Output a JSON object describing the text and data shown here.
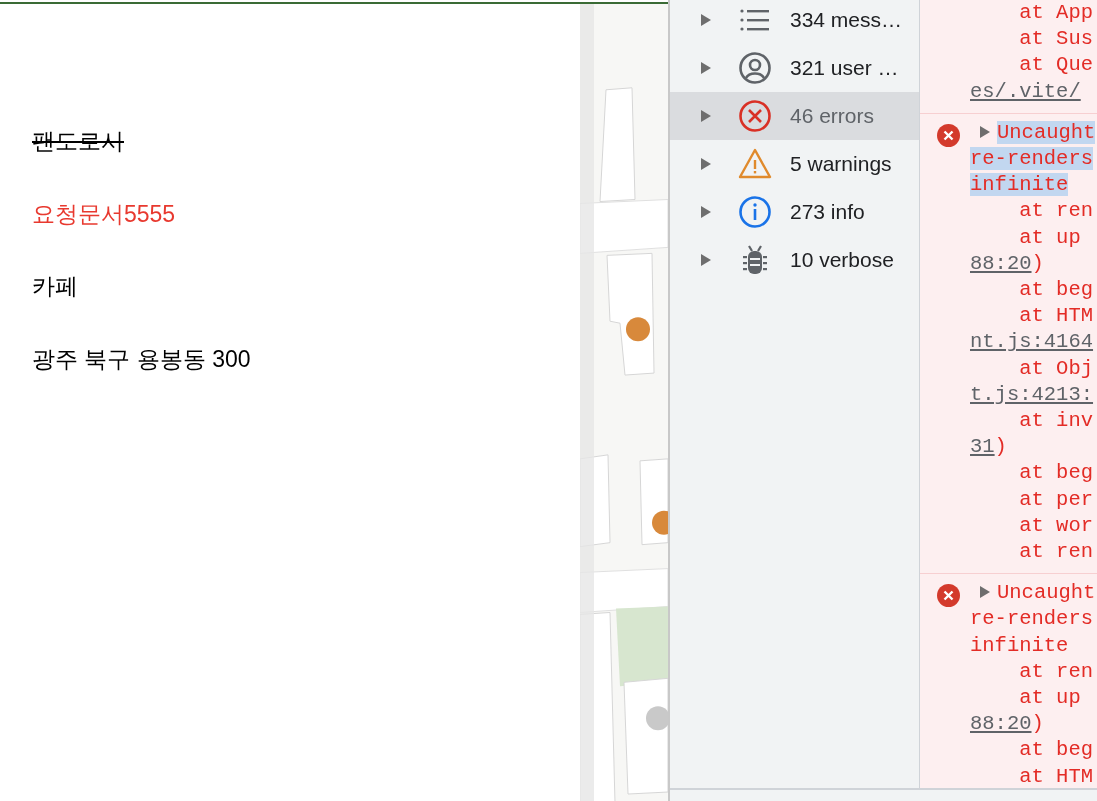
{
  "place_card": {
    "fields": [
      {
        "text": "팬도로시",
        "struck": true,
        "color": "#000000"
      },
      {
        "text": "요청문서5555",
        "struck": false,
        "color": "#e8392f"
      },
      {
        "text": "카페",
        "struck": false,
        "color": "#000000"
      },
      {
        "text": "광주 북구 용봉동 300",
        "struck": false,
        "color": "#000000"
      }
    ]
  },
  "console_sidebar": {
    "items": [
      {
        "kind": "messages",
        "label": "334 mess…",
        "selected": false,
        "expanded": false
      },
      {
        "kind": "user",
        "label": "321 user …",
        "selected": false,
        "expanded": false
      },
      {
        "kind": "errors",
        "label": "46 errors",
        "selected": true,
        "expanded": false
      },
      {
        "kind": "warnings",
        "label": "5 warnings",
        "selected": false,
        "expanded": false
      },
      {
        "kind": "info",
        "label": "273 info",
        "selected": false,
        "expanded": false
      },
      {
        "kind": "verbose",
        "label": "10 verbose",
        "selected": false,
        "expanded": false
      }
    ]
  },
  "console": {
    "entries": [
      {
        "kind": "continuation",
        "lines": [
          {
            "kind": "frame",
            "text": "at App"
          },
          {
            "kind": "frame",
            "text": "at Sus"
          },
          {
            "kind": "frame",
            "text": "at Que"
          },
          {
            "kind": "link",
            "text": "es/.vite/"
          }
        ]
      },
      {
        "kind": "error",
        "expanded": false,
        "lines": [
          {
            "kind": "message",
            "text": "Uncaught",
            "selected": true
          },
          {
            "kind": "message",
            "text": "re-renders",
            "selected": true
          },
          {
            "kind": "message",
            "text": "infinite",
            "selected": true
          },
          {
            "kind": "frame",
            "text": "at ren"
          },
          {
            "kind": "frame",
            "text": "at up"
          },
          {
            "kind": "link",
            "text": "88:20",
            "suffix": ")"
          },
          {
            "kind": "frame",
            "text": "at beg"
          },
          {
            "kind": "frame",
            "text": "at HTM"
          },
          {
            "kind": "link",
            "text": "nt.js:4164"
          },
          {
            "kind": "frame",
            "text": "at Obj"
          },
          {
            "kind": "link",
            "text": "t.js:4213:"
          },
          {
            "kind": "frame",
            "text": "at inv"
          },
          {
            "kind": "link",
            "text": "31",
            "suffix": ")"
          },
          {
            "kind": "frame",
            "text": "at beg"
          },
          {
            "kind": "frame",
            "text": "at per"
          },
          {
            "kind": "frame",
            "text": "at wor"
          },
          {
            "kind": "frame",
            "text": "at ren"
          }
        ]
      },
      {
        "kind": "error",
        "expanded": false,
        "lines": [
          {
            "kind": "message",
            "text": "Uncaught",
            "selected": false
          },
          {
            "kind": "message",
            "text": "re-renders",
            "selected": false
          },
          {
            "kind": "message",
            "text": "infinite",
            "selected": false
          },
          {
            "kind": "frame",
            "text": "at ren"
          },
          {
            "kind": "frame",
            "text": "at up"
          },
          {
            "kind": "link",
            "text": "88:20",
            "suffix": ")"
          },
          {
            "kind": "frame",
            "text": "at beg"
          },
          {
            "kind": "frame",
            "text": "at HTM"
          }
        ]
      }
    ]
  }
}
